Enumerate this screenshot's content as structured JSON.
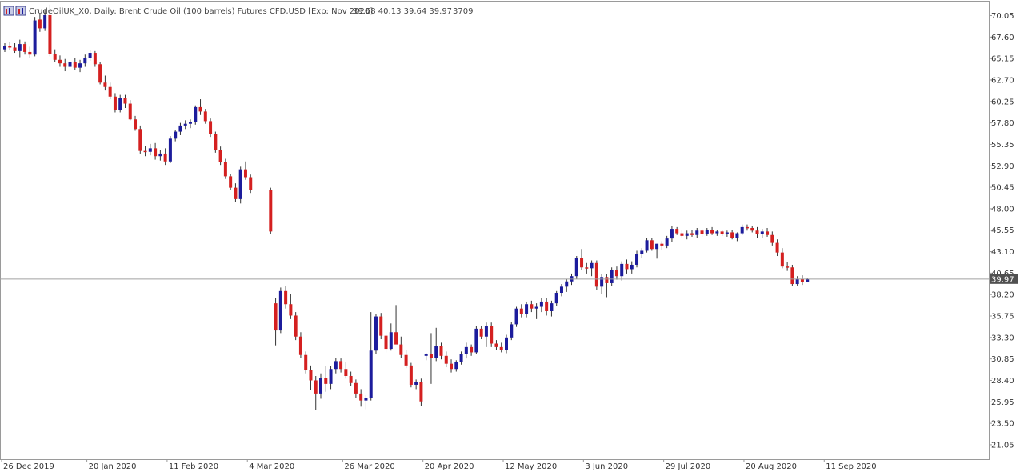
{
  "header": {
    "title": "CrudeOilUK_X0, Daily:  Brent Crude Oil (100 barrels) Futures CFD,USD [Exp: Nov 2020]",
    "ohlc": "39.68 40.13 39.64 39.97",
    "volume": "3709"
  },
  "colors": {
    "bull": "#1c1c9c",
    "bear": "#d42020",
    "wick": "#333333",
    "frame": "#9a9a9a",
    "price_line": "#a0a0a0",
    "price_label_bg": "#505050",
    "price_label_text": "#ffffff"
  },
  "chart_data": {
    "type": "candlestick",
    "title": "CrudeOilUK_X0, Daily:  Brent Crude Oil (100 barrels) Futures CFD,USD [Exp: Nov 2020]",
    "symbol": "CrudeOilUK_X0",
    "timeframe": "Daily",
    "ylim": [
      19.4,
      71.65
    ],
    "y_axis_side": "right",
    "grid": false,
    "y_ticks": [
      "70.05",
      "67.60",
      "65.15",
      "62.70",
      "60.25",
      "57.80",
      "55.35",
      "52.90",
      "50.45",
      "48.00",
      "45.55",
      "43.10",
      "40.65",
      "38.20",
      "35.75",
      "33.30",
      "30.85",
      "28.40",
      "25.95",
      "23.50",
      "21.05"
    ],
    "x_ticks": [
      {
        "label": "26 Dec 2019",
        "index": 0
      },
      {
        "label": "20 Jan 2020",
        "index": 17
      },
      {
        "label": "11 Feb 2020",
        "index": 33
      },
      {
        "label": "4 Mar 2020",
        "index": 49
      },
      {
        "label": "26 Mar 2020",
        "index": 65
      },
      {
        "label": "20 Apr 2020",
        "index": 81
      },
      {
        "label": "12 May 2020",
        "index": 97
      },
      {
        "label": "3 Jun 2020",
        "index": 113
      },
      {
        "label": "29 Jul 2020",
        "index": 129
      },
      {
        "label": "20 Aug 2020",
        "index": 145
      },
      {
        "label": "11 Sep 2020",
        "index": 161
      }
    ],
    "gap": {
      "after_index": 49,
      "slots": 3
    },
    "current_price": 39.97,
    "current_price_label": "39.97",
    "candles": [
      [
        66.2,
        66.9,
        65.9,
        66.6
      ],
      [
        66.6,
        67.0,
        66.1,
        66.4
      ],
      [
        66.4,
        66.9,
        65.8,
        66.0
      ],
      [
        66.0,
        67.3,
        65.3,
        66.8
      ],
      [
        66.8,
        67.1,
        65.6,
        65.9
      ],
      [
        65.9,
        66.5,
        65.2,
        65.6
      ],
      [
        65.6,
        69.9,
        65.4,
        69.5
      ],
      [
        69.6,
        70.2,
        68.2,
        68.6
      ],
      [
        68.6,
        70.8,
        68.3,
        70.1
      ],
      [
        70.1,
        71.3,
        65.4,
        65.7
      ],
      [
        65.7,
        66.2,
        64.8,
        65.0
      ],
      [
        65.0,
        65.5,
        64.2,
        64.6
      ],
      [
        64.6,
        65.1,
        63.7,
        64.2
      ],
      [
        64.2,
        65.0,
        63.8,
        64.8
      ],
      [
        64.8,
        65.2,
        63.8,
        64.1
      ],
      [
        64.1,
        65.0,
        63.6,
        64.6
      ],
      [
        64.6,
        65.6,
        64.2,
        65.2
      ],
      [
        65.2,
        66.1,
        64.9,
        65.8
      ],
      [
        65.8,
        66.0,
        64.2,
        64.5
      ],
      [
        64.5,
        64.8,
        62.2,
        62.4
      ],
      [
        62.4,
        63.2,
        61.5,
        61.9
      ],
      [
        61.9,
        62.4,
        60.5,
        60.8
      ],
      [
        60.8,
        61.2,
        59.0,
        59.3
      ],
      [
        59.3,
        61.0,
        59.0,
        60.6
      ],
      [
        60.6,
        61.0,
        59.5,
        60.0
      ],
      [
        60.0,
        60.4,
        58.1,
        58.2
      ],
      [
        58.2,
        58.6,
        56.9,
        57.1
      ],
      [
        57.1,
        57.5,
        54.3,
        54.6
      ],
      [
        54.6,
        55.2,
        54.0,
        54.5
      ],
      [
        54.5,
        55.4,
        54.1,
        54.9
      ],
      [
        54.9,
        55.5,
        53.6,
        54.0
      ],
      [
        54.0,
        54.7,
        53.5,
        54.3
      ],
      [
        54.3,
        54.9,
        53.0,
        53.4
      ],
      [
        53.4,
        56.3,
        53.2,
        56.0
      ],
      [
        56.0,
        57.0,
        55.7,
        56.8
      ],
      [
        56.8,
        57.8,
        56.4,
        57.5
      ],
      [
        57.5,
        58.1,
        57.1,
        57.7
      ],
      [
        57.7,
        58.2,
        57.2,
        57.9
      ],
      [
        57.9,
        59.8,
        57.6,
        59.6
      ],
      [
        59.6,
        60.5,
        58.7,
        59.1
      ],
      [
        59.1,
        59.4,
        57.7,
        58.0
      ],
      [
        58.0,
        58.3,
        56.2,
        56.5
      ],
      [
        56.5,
        56.8,
        54.4,
        54.7
      ],
      [
        54.7,
        55.1,
        53.0,
        53.3
      ],
      [
        53.3,
        53.7,
        51.4,
        51.7
      ],
      [
        51.7,
        52.0,
        50.1,
        50.4
      ],
      [
        50.4,
        50.9,
        48.8,
        49.1
      ],
      [
        49.1,
        52.8,
        48.6,
        52.5
      ],
      [
        52.5,
        53.4,
        51.3,
        51.6
      ],
      [
        51.6,
        51.9,
        49.8,
        50.1
      ],
      [
        50.1,
        50.4,
        45.1,
        45.4
      ],
      [
        37.2,
        37.8,
        32.4,
        34.1
      ],
      [
        34.1,
        39.0,
        33.8,
        38.6
      ],
      [
        38.6,
        39.2,
        36.6,
        37.1
      ],
      [
        37.1,
        38.3,
        35.4,
        35.8
      ],
      [
        35.8,
        36.2,
        33.0,
        33.4
      ],
      [
        33.4,
        33.9,
        31.0,
        31.3
      ],
      [
        31.3,
        31.7,
        29.2,
        29.6
      ],
      [
        29.6,
        30.1,
        27.3,
        28.4
      ],
      [
        28.4,
        28.9,
        25.0,
        26.9
      ],
      [
        26.9,
        29.2,
        26.3,
        28.7
      ],
      [
        28.7,
        30.0,
        27.1,
        28.0
      ],
      [
        28.0,
        30.0,
        27.4,
        29.7
      ],
      [
        29.7,
        31.0,
        29.2,
        30.6
      ],
      [
        30.6,
        30.9,
        29.3,
        29.7
      ],
      [
        29.7,
        30.5,
        28.6,
        28.9
      ],
      [
        28.9,
        29.4,
        27.8,
        28.1
      ],
      [
        28.1,
        28.5,
        26.4,
        26.9
      ],
      [
        26.9,
        27.4,
        25.4,
        26.1
      ],
      [
        26.1,
        26.7,
        25.1,
        26.4
      ],
      [
        26.4,
        36.2,
        26.1,
        31.8
      ],
      [
        31.8,
        36.0,
        31.4,
        35.7
      ],
      [
        35.7,
        36.1,
        33.1,
        33.5
      ],
      [
        33.5,
        33.9,
        31.6,
        32.0
      ],
      [
        32.0,
        34.9,
        31.8,
        33.9
      ],
      [
        33.9,
        37.0,
        33.1,
        32.5
      ],
      [
        32.5,
        33.4,
        31.0,
        31.3
      ],
      [
        31.3,
        31.9,
        29.8,
        30.1
      ],
      [
        30.1,
        30.4,
        27.6,
        27.9
      ],
      [
        27.9,
        28.5,
        27.4,
        28.2
      ],
      [
        28.2,
        28.6,
        25.5,
        26.0
      ],
      [
        31.2,
        31.5,
        30.7,
        31.4
      ],
      [
        31.4,
        33.8,
        28.0,
        31.0
      ],
      [
        31.0,
        34.4,
        30.6,
        32.3
      ],
      [
        32.3,
        32.7,
        30.8,
        31.2
      ],
      [
        31.2,
        31.7,
        29.9,
        30.3
      ],
      [
        30.3,
        30.8,
        29.3,
        29.7
      ],
      [
        29.7,
        30.7,
        29.4,
        30.5
      ],
      [
        30.5,
        31.7,
        30.2,
        31.4
      ],
      [
        31.4,
        32.7,
        30.9,
        32.2
      ],
      [
        32.2,
        32.5,
        31.2,
        31.6
      ],
      [
        31.6,
        34.6,
        31.4,
        34.3
      ],
      [
        34.3,
        34.6,
        33.1,
        33.4
      ],
      [
        33.4,
        35.0,
        32.2,
        34.6
      ],
      [
        34.6,
        35.0,
        32.2,
        32.6
      ],
      [
        32.6,
        33.0,
        31.9,
        32.2
      ],
      [
        32.2,
        32.7,
        31.6,
        31.9
      ],
      [
        31.9,
        33.6,
        31.5,
        33.3
      ],
      [
        33.3,
        35.1,
        33.0,
        34.8
      ],
      [
        34.8,
        36.8,
        34.5,
        36.6
      ],
      [
        36.6,
        37.1,
        35.6,
        36.0
      ],
      [
        36.0,
        37.4,
        35.6,
        37.1
      ],
      [
        37.1,
        37.5,
        36.2,
        36.6
      ],
      [
        36.6,
        37.2,
        35.4,
        36.8
      ],
      [
        36.8,
        37.8,
        36.2,
        37.4
      ],
      [
        37.4,
        37.8,
        35.8,
        36.3
      ],
      [
        36.3,
        37.5,
        35.7,
        37.2
      ],
      [
        37.2,
        38.6,
        36.9,
        38.4
      ],
      [
        38.4,
        39.4,
        38.0,
        39.1
      ],
      [
        39.1,
        40.0,
        38.5,
        39.7
      ],
      [
        39.7,
        40.6,
        39.3,
        40.3
      ],
      [
        40.3,
        42.6,
        40.0,
        42.4
      ],
      [
        42.4,
        43.4,
        41.0,
        41.3
      ],
      [
        41.3,
        41.8,
        40.6,
        41.2
      ],
      [
        41.2,
        42.1,
        40.3,
        41.8
      ],
      [
        41.8,
        42.1,
        38.7,
        39.1
      ],
      [
        39.1,
        40.5,
        38.3,
        40.2
      ],
      [
        40.2,
        40.5,
        37.9,
        39.5
      ],
      [
        39.5,
        41.3,
        39.2,
        41.0
      ],
      [
        41.0,
        41.4,
        39.9,
        40.3
      ],
      [
        40.3,
        42.0,
        39.8,
        41.7
      ],
      [
        41.7,
        42.2,
        40.6,
        41.1
      ],
      [
        41.1,
        42.0,
        40.6,
        41.6
      ],
      [
        41.6,
        43.2,
        41.3,
        42.8
      ],
      [
        42.8,
        43.5,
        42.4,
        43.2
      ],
      [
        43.2,
        44.7,
        43.0,
        44.4
      ],
      [
        44.4,
        44.7,
        43.2,
        43.4
      ],
      [
        43.4,
        44.0,
        42.3,
        44.0
      ],
      [
        44.0,
        44.3,
        43.3,
        43.8
      ],
      [
        43.8,
        44.9,
        43.5,
        44.6
      ],
      [
        44.6,
        46.0,
        44.2,
        45.7
      ],
      [
        45.7,
        45.9,
        45.0,
        45.2
      ],
      [
        45.2,
        45.6,
        44.6,
        44.9
      ],
      [
        44.9,
        45.5,
        44.5,
        45.2
      ],
      [
        45.2,
        45.6,
        44.8,
        45.0
      ],
      [
        45.0,
        45.8,
        44.7,
        45.5
      ],
      [
        45.5,
        45.7,
        44.8,
        45.1
      ],
      [
        45.1,
        45.8,
        44.9,
        45.6
      ],
      [
        45.6,
        45.9,
        45.0,
        45.2
      ],
      [
        45.2,
        45.6,
        44.9,
        45.4
      ],
      [
        45.4,
        45.6,
        44.9,
        45.1
      ],
      [
        45.1,
        45.5,
        44.8,
        45.3
      ],
      [
        45.3,
        45.6,
        44.5,
        44.7
      ],
      [
        44.7,
        45.3,
        44.3,
        45.2
      ],
      [
        45.2,
        46.2,
        45.0,
        45.9
      ],
      [
        45.9,
        46.2,
        45.5,
        45.8
      ],
      [
        45.8,
        46.0,
        45.3,
        45.5
      ],
      [
        45.5,
        45.9,
        44.7,
        45.1
      ],
      [
        45.1,
        45.7,
        44.7,
        45.4
      ],
      [
        45.4,
        45.8,
        44.8,
        45.0
      ],
      [
        45.0,
        45.4,
        43.8,
        44.1
      ],
      [
        44.1,
        44.5,
        42.6,
        43.0
      ],
      [
        43.0,
        43.5,
        41.2,
        41.4
      ],
      [
        41.4,
        41.9,
        40.9,
        41.3
      ],
      [
        41.3,
        41.6,
        39.2,
        39.4
      ],
      [
        39.4,
        40.3,
        39.2,
        40.0
      ],
      [
        40.0,
        40.4,
        39.3,
        39.6
      ],
      [
        39.68,
        40.13,
        39.64,
        39.97
      ]
    ]
  }
}
